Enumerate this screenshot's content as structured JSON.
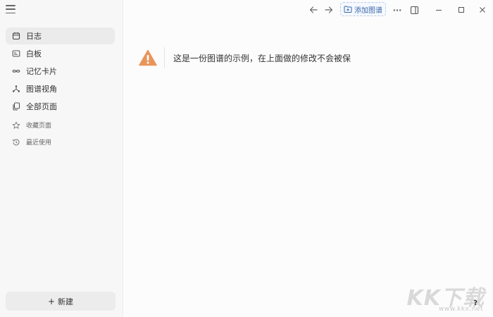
{
  "sidebar": {
    "menu_icon": "hamburger-icon",
    "items": [
      {
        "label": "日志",
        "icon": "calendar-icon",
        "active": true
      },
      {
        "label": "白板",
        "icon": "whiteboard-icon"
      },
      {
        "label": "记忆卡片",
        "icon": "infinity-icon"
      },
      {
        "label": "图谱视角",
        "icon": "graph-icon"
      },
      {
        "label": "全部页面",
        "icon": "pages-icon"
      }
    ],
    "secondary": [
      {
        "label": "收藏页面",
        "icon": "star-icon"
      },
      {
        "label": "最近使用",
        "icon": "history-icon"
      }
    ],
    "new_button": {
      "plus": "+",
      "label": "新建"
    }
  },
  "topbar": {
    "add_graph_label": "添加图谱",
    "more_glyph": "···"
  },
  "main": {
    "notice_text": "这是一份图谱的示例，在上面做的修改不会被保",
    "help_label": "?"
  },
  "watermark": {
    "text": "KK下载",
    "url": "www.kkx.net"
  },
  "colors": {
    "warning": "#e9955a",
    "accent": "#3b66a8"
  }
}
